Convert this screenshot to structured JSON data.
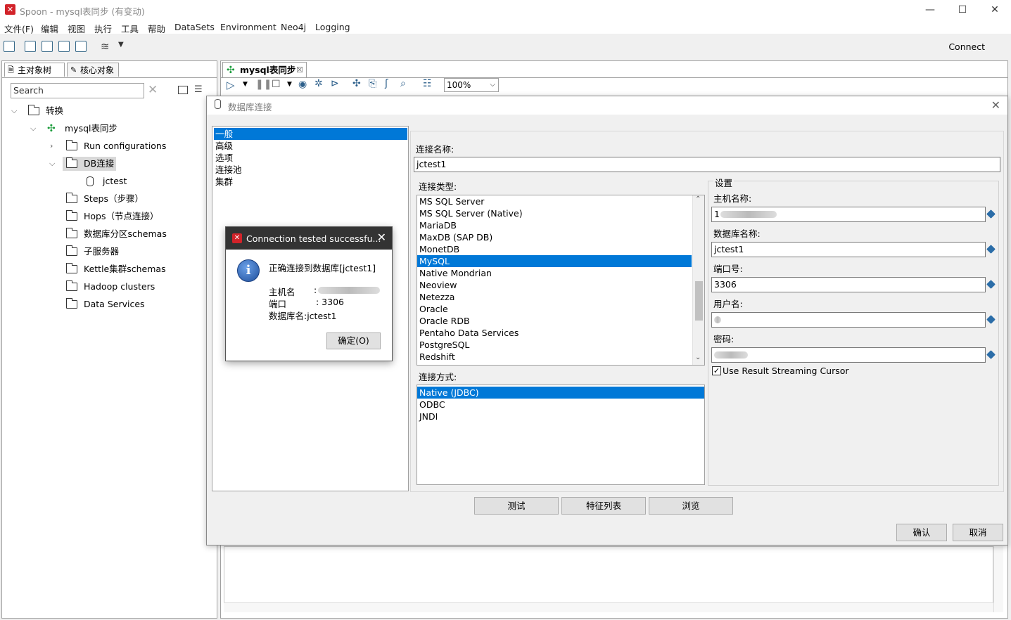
{
  "window": {
    "title": "Spoon - mysql表同步 (有变动)",
    "controls": {
      "minimize": "—",
      "maximize": "☐",
      "close": "✕"
    }
  },
  "menu": [
    "文件(F)",
    "编辑",
    "视图",
    "执行",
    "工具",
    "帮助",
    "DataSets",
    "Environment",
    "Neo4j",
    "Logging"
  ],
  "toolbar": {
    "connect_label": "Connect"
  },
  "left_panel": {
    "tabs": [
      "主对象树",
      "核心对象"
    ],
    "search_placeholder": "Search",
    "tree": [
      {
        "label": "转换",
        "level": 0,
        "expanded": true,
        "icon": "folder-icon"
      },
      {
        "label": "mysql表同步",
        "level": 1,
        "expanded": true,
        "icon": "transformation-icon"
      },
      {
        "label": "Run configurations",
        "level": 2,
        "expanded": false,
        "icon": "folder-icon"
      },
      {
        "label": "DB连接",
        "level": 2,
        "expanded": true,
        "icon": "folder-icon",
        "selected": true
      },
      {
        "label": "jctest",
        "level": 3,
        "icon": "database-icon"
      },
      {
        "label": "Steps（步骤）",
        "level": 2,
        "icon": "folder-icon"
      },
      {
        "label": "Hops（节点连接）",
        "level": 2,
        "icon": "folder-icon"
      },
      {
        "label": "数据库分区schemas",
        "level": 2,
        "icon": "folder-icon"
      },
      {
        "label": "子服务器",
        "level": 2,
        "icon": "folder-icon"
      },
      {
        "label": "Kettle集群schemas",
        "level": 2,
        "icon": "folder-icon"
      },
      {
        "label": "Hadoop clusters",
        "level": 2,
        "icon": "folder-icon"
      },
      {
        "label": "Data Services",
        "level": 2,
        "icon": "folder-icon"
      }
    ]
  },
  "workspace": {
    "tab_label": "mysql表同步",
    "zoom": "100%"
  },
  "db_dialog": {
    "title": "数据库连接",
    "nav": [
      "一般",
      "高级",
      "选项",
      "连接池",
      "集群"
    ],
    "nav_selected": 0,
    "connection_name_label": "连接名称:",
    "connection_name": "jctest1",
    "connection_type_label": "连接类型:",
    "connection_types": [
      "MS SQL Server",
      "MS SQL Server (Native)",
      "MariaDB",
      "MaxDB (SAP DB)",
      "MonetDB",
      "MySQL",
      "Native Mondrian",
      "Neoview",
      "Netezza",
      "Oracle",
      "Oracle RDB",
      "Pentaho Data Services",
      "PostgreSQL",
      "Redshift"
    ],
    "connection_type_selected": 5,
    "access_label": "连接方式:",
    "access_methods": [
      "Native (JDBC)",
      "ODBC",
      "JNDI"
    ],
    "access_selected": 0,
    "settings": {
      "group_label": "设置",
      "host_label": "主机名称:",
      "host_value": "1",
      "db_label": "数据库名称:",
      "db_value": "jctest1",
      "port_label": "端口号:",
      "port_value": "3306",
      "user_label": "用户名:",
      "user_value": "",
      "password_label": "密码:",
      "password_value": "",
      "streaming_label": "Use Result Streaming Cursor",
      "streaming_checked": true
    },
    "buttons": {
      "test": "测试",
      "features": "特征列表",
      "browse": "浏览",
      "ok": "确认",
      "cancel": "取消"
    }
  },
  "message_box": {
    "title": "Connection tested successfu...",
    "message": "正确连接到数据库[jctest1]",
    "host_label": "主机名",
    "host_sep": ":",
    "port_label": "端口",
    "port_value": ": 3306",
    "db_line": "数据库名:jctest1",
    "ok": "确定(O)"
  }
}
